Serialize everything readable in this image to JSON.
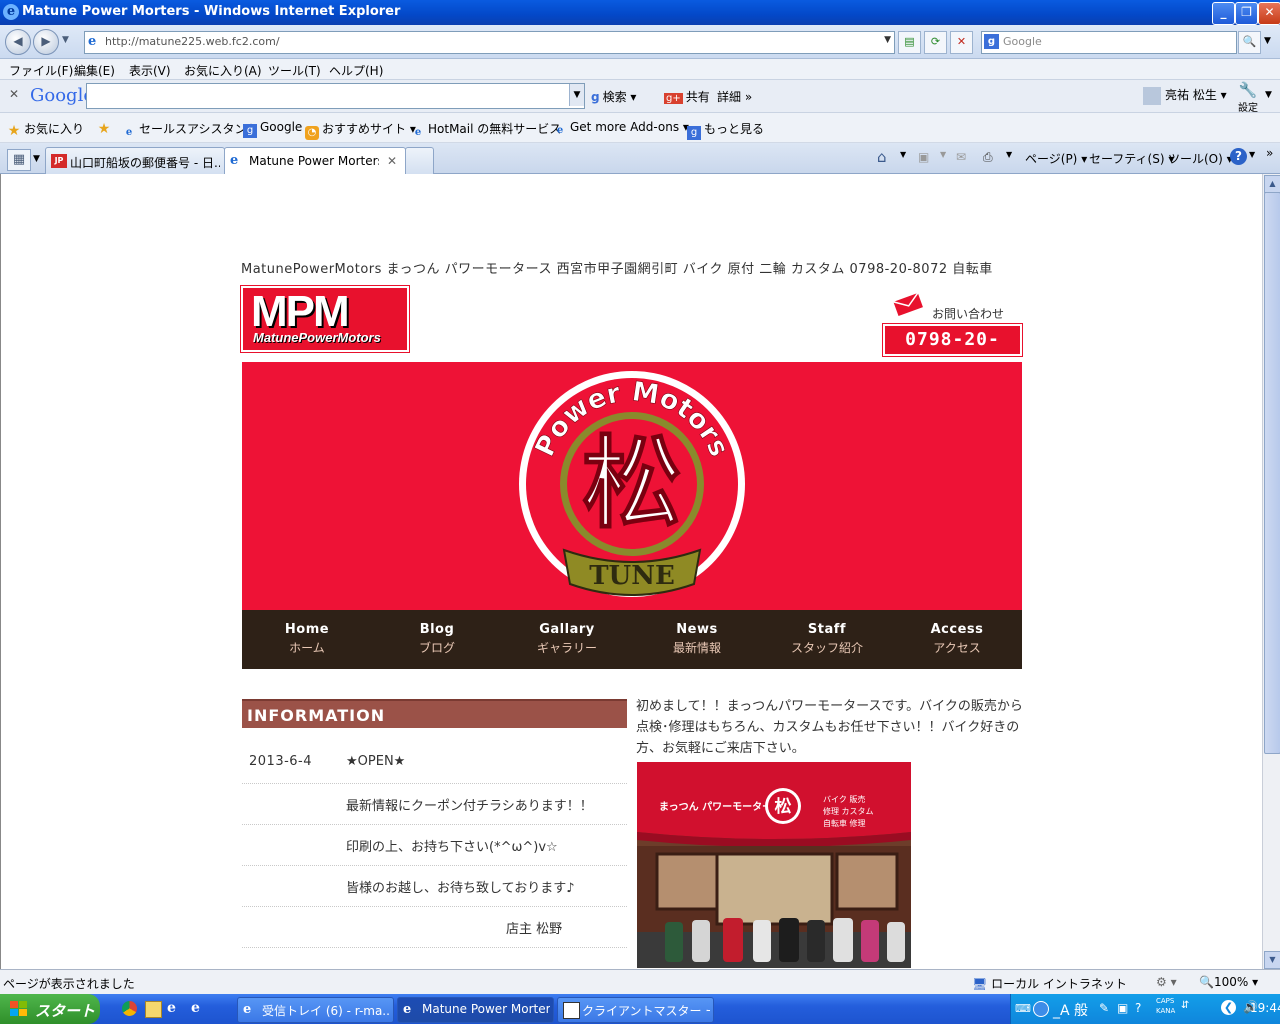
{
  "window": {
    "title": "Matune Power Morters - Windows Internet Explorer"
  },
  "address_bar": {
    "url": "http://matune225.web.fc2.com/",
    "search_placeholder": "Google"
  },
  "menu": [
    "ファイル(F)",
    "編集(E)",
    "表示(V)",
    "お気に入り(A)",
    "ツール(T)",
    "ヘルプ(H)"
  ],
  "google_toolbar": {
    "logo": "Google",
    "search_label": "検索",
    "share_label": "共有",
    "more_label": "詳細",
    "user_name": "亮祐 松生",
    "settings_label": "設定"
  },
  "favorites_bar": {
    "favorites_label": "お気に入り",
    "items": [
      "セールスアシスタント",
      "Google",
      "おすすめサイト",
      "HotMail の無料サービス",
      "Get more Add-ons",
      "もっと見る"
    ]
  },
  "tabs": [
    {
      "label": "山口町船坂の郵便番号 - 日..."
    },
    {
      "label": "Matune Power Morters"
    }
  ],
  "command_bar": {
    "page_label": "ページ(P)",
    "safety_label": "セーフティ(S)",
    "tools_label": "ツール(O)"
  },
  "page": {
    "tagline": "MatunePowerMotors まっつん パワーモータース 西宮市甲子園網引町 バイク 原付 二輪 カスタム 0798-20-8072 自転車",
    "logo_big": "MPM",
    "logo_small": "MatunePowerMotors",
    "contact_label": "お問い合わせ",
    "phone": "0798-20-8072",
    "hero": {
      "ring_text": "Power Motors",
      "kanji": "松",
      "banner_text": "TUNE"
    },
    "nav": [
      {
        "en": "Home",
        "jp": "ホーム"
      },
      {
        "en": "Blog",
        "jp": "ブログ"
      },
      {
        "en": "Gallary",
        "jp": "ギャラリー"
      },
      {
        "en": "News",
        "jp": "最新情報"
      },
      {
        "en": "Staff",
        "jp": "スタッフ紹介"
      },
      {
        "en": "Access",
        "jp": "アクセス"
      }
    ],
    "information_title": "INFORMATION",
    "information_rows": [
      {
        "date": "2013-6-4",
        "text": "★OPEN★"
      },
      {
        "date": "",
        "text": "最新情報にクーポン付チラシあります！！"
      },
      {
        "date": "",
        "text": "印刷の上、お持ち下さい(*^ω^)v☆"
      },
      {
        "date": "",
        "text": "皆様のお越し、お待ち致しております♪"
      },
      {
        "date": "",
        "text": "店主 松野"
      }
    ],
    "intro_text": "初めまして！！まっつんパワーモータースです。バイクの販売から点検･修理はもちろん、カスタムもお任せ下さい！！バイク好きの方、お気軽にご来店下さい。",
    "shop_sign": {
      "name": "まっつん パワーモータース",
      "services": [
        "バイク 販売",
        "修理 カスタム",
        "自転車 修理"
      ]
    }
  },
  "status_bar": {
    "message": "ページが表示されました",
    "zone": "ローカル イントラネット",
    "zoom": "100%"
  },
  "taskbar": {
    "start_label": "スタート",
    "buttons": [
      "受信トレイ (6) - r-ma...",
      "Matune Power Morter...",
      "クライアントマスター ー ..."
    ],
    "tray_ime": "般",
    "clock": "19:44",
    "caps": "CAPS",
    "kana": "KANA"
  }
}
